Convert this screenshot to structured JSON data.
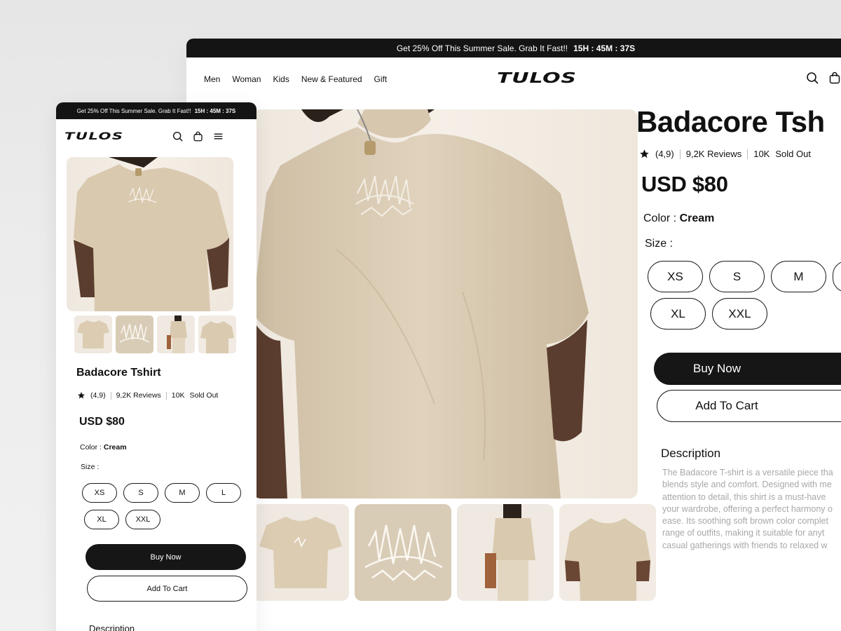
{
  "promo": {
    "text": "Get 25% Off This Summer Sale. Grab It Fast!!",
    "timer": "15H : 45M : 37S"
  },
  "brand": {
    "logo": "TULOS"
  },
  "nav": {
    "links": [
      "Men",
      "Woman",
      "Kids",
      "New & Featured",
      "Gift"
    ]
  },
  "product": {
    "title_desktop": "Badacore Tsh",
    "title_mobile": "Badacore Tshirt",
    "rating": "(4,9)",
    "reviews": "9,2K Reviews",
    "sold_count": "10K",
    "sold_label": "Sold Out",
    "price": "USD $80",
    "color_label": "Color :",
    "color_value": "Cream",
    "size_label": "Size :",
    "sizes_desktop": [
      "XS",
      "S",
      "M",
      "",
      "XL",
      "XXL"
    ],
    "sizes_mobile": [
      "XS",
      "S",
      "M",
      "L",
      "XL",
      "XXL"
    ],
    "buy_now": "Buy Now",
    "add_to_cart": "Add To Cart",
    "description_title": "Description",
    "description_lines": [
      "The Badacore T-shirt is a versatile piece tha",
      "blends style and comfort. Designed with me",
      "attention to detail, this shirt is a must-have",
      "your wardrobe, offering a perfect harmony o",
      "ease. Its soothing soft brown color complet",
      "range of outfits, making it suitable for anyt",
      "casual gatherings with friends to relaxed w"
    ],
    "description_mobile_title": "Description"
  },
  "colors": {
    "dark": "#141414",
    "shirt": "#dccdb6",
    "background": "#f4eee6",
    "muted_text": "#a8a8a8"
  },
  "icons": [
    "search-icon",
    "bag-icon",
    "menu-icon",
    "star-icon"
  ]
}
